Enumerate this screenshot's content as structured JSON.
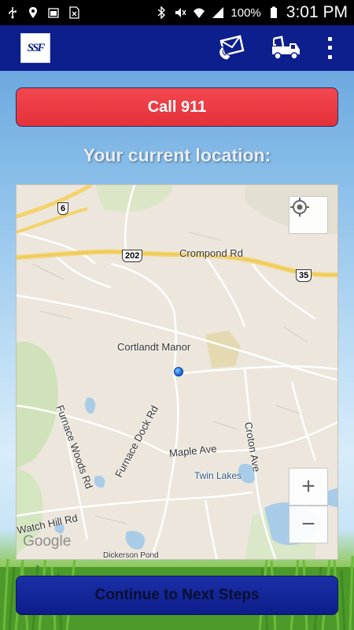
{
  "status_bar": {
    "battery_percent": "100%",
    "time": "3:01 PM",
    "left_icons": [
      "usb-icon",
      "location-pin-icon",
      "battery-full-icon",
      "sim-icon"
    ],
    "right_icons": [
      "bluetooth-icon",
      "mute-icon",
      "wifi-icon",
      "signal-icon",
      "battery-icon"
    ]
  },
  "app_bar": {
    "logo_text": "SSF",
    "actions": [
      "phone-contact-icon",
      "tow-truck-icon",
      "overflow-menu-icon"
    ],
    "color": "#0c1f8c"
  },
  "call_button": {
    "label": "Call 911",
    "color": "#e83a42"
  },
  "location_heading": "Your current location:",
  "map": {
    "labels": {
      "crompond": "Crompond Rd",
      "cortlandt": "Cortlandt Manor",
      "furnace_dock": "Furnace Dock Rd",
      "furnace_woods": "Furnace Woods Rd",
      "maple": "Maple Ave",
      "croton": "Croton Ave",
      "twin_lakes": "Twin Lakes",
      "watch_hill": "Watch Hill Rd",
      "dickerson": "Dickerson Pond"
    },
    "shields": {
      "route_6": "6",
      "route_202": "202",
      "route_35": "35"
    },
    "zoom_in": "+",
    "zoom_out": "−",
    "watermark": "Google"
  },
  "continue_button": {
    "label": "Continue to Next Steps"
  }
}
